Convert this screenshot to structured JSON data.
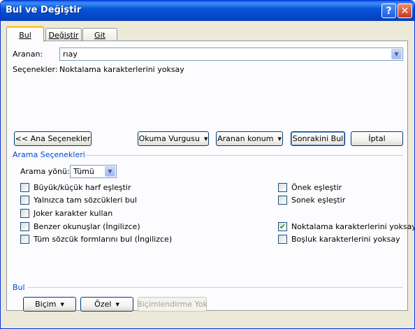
{
  "window": {
    "title": "Bul ve Değiştir"
  },
  "titlebar_buttons": {
    "help": "?",
    "close": "✕"
  },
  "tabs": [
    {
      "label": "Bul",
      "active": true
    },
    {
      "label": "Değiştir",
      "active": false
    },
    {
      "label": "Git",
      "active": false
    }
  ],
  "find": {
    "label": "Aranan:",
    "value": "rıay",
    "options_label": "Seçenekler:",
    "options_value": "Noktalama karakterlerini yoksay"
  },
  "buttons": {
    "less": "<< Ana Seçenekler",
    "reading_highlight": "Okuma Vurgusu",
    "find_in": "Aranan konum",
    "find_next": "Sonrakini Bul",
    "cancel": "İptal"
  },
  "search_options": {
    "title": "Arama Seçenekleri",
    "direction_label": "Arama yönü:",
    "direction_value": "Tümü",
    "left": [
      {
        "label": "Büyük/küçük harf eşleştir",
        "checked": false
      },
      {
        "label": "Yalnızca tam sözcükleri bul",
        "checked": false
      },
      {
        "label": "Joker karakter kullan",
        "checked": false
      },
      {
        "label": "Benzer okunuşlar (İngilizce)",
        "checked": false
      },
      {
        "label": "Tüm sözcük formlarını bul (İngilizce)",
        "checked": false
      }
    ],
    "right": [
      {
        "label": "Önek eşleştir",
        "checked": false
      },
      {
        "label": "Sonek eşleştir",
        "checked": false
      },
      {
        "label": "Noktalama karakterlerini yoksay",
        "checked": true
      },
      {
        "label": "Boşluk karakterlerini yoksay",
        "checked": false
      }
    ]
  },
  "find_section": {
    "title": "Bul",
    "format": "Biçim",
    "special": "Özel",
    "no_formatting": "Biçimlendirme Yok"
  },
  "icons": {
    "dropdown": "chevron-down-icon",
    "check": "checkmark-icon"
  },
  "colors": {
    "titlebar": "#0755d8",
    "group_title": "#0046d5",
    "dialog_bg": "#ece9d8"
  }
}
